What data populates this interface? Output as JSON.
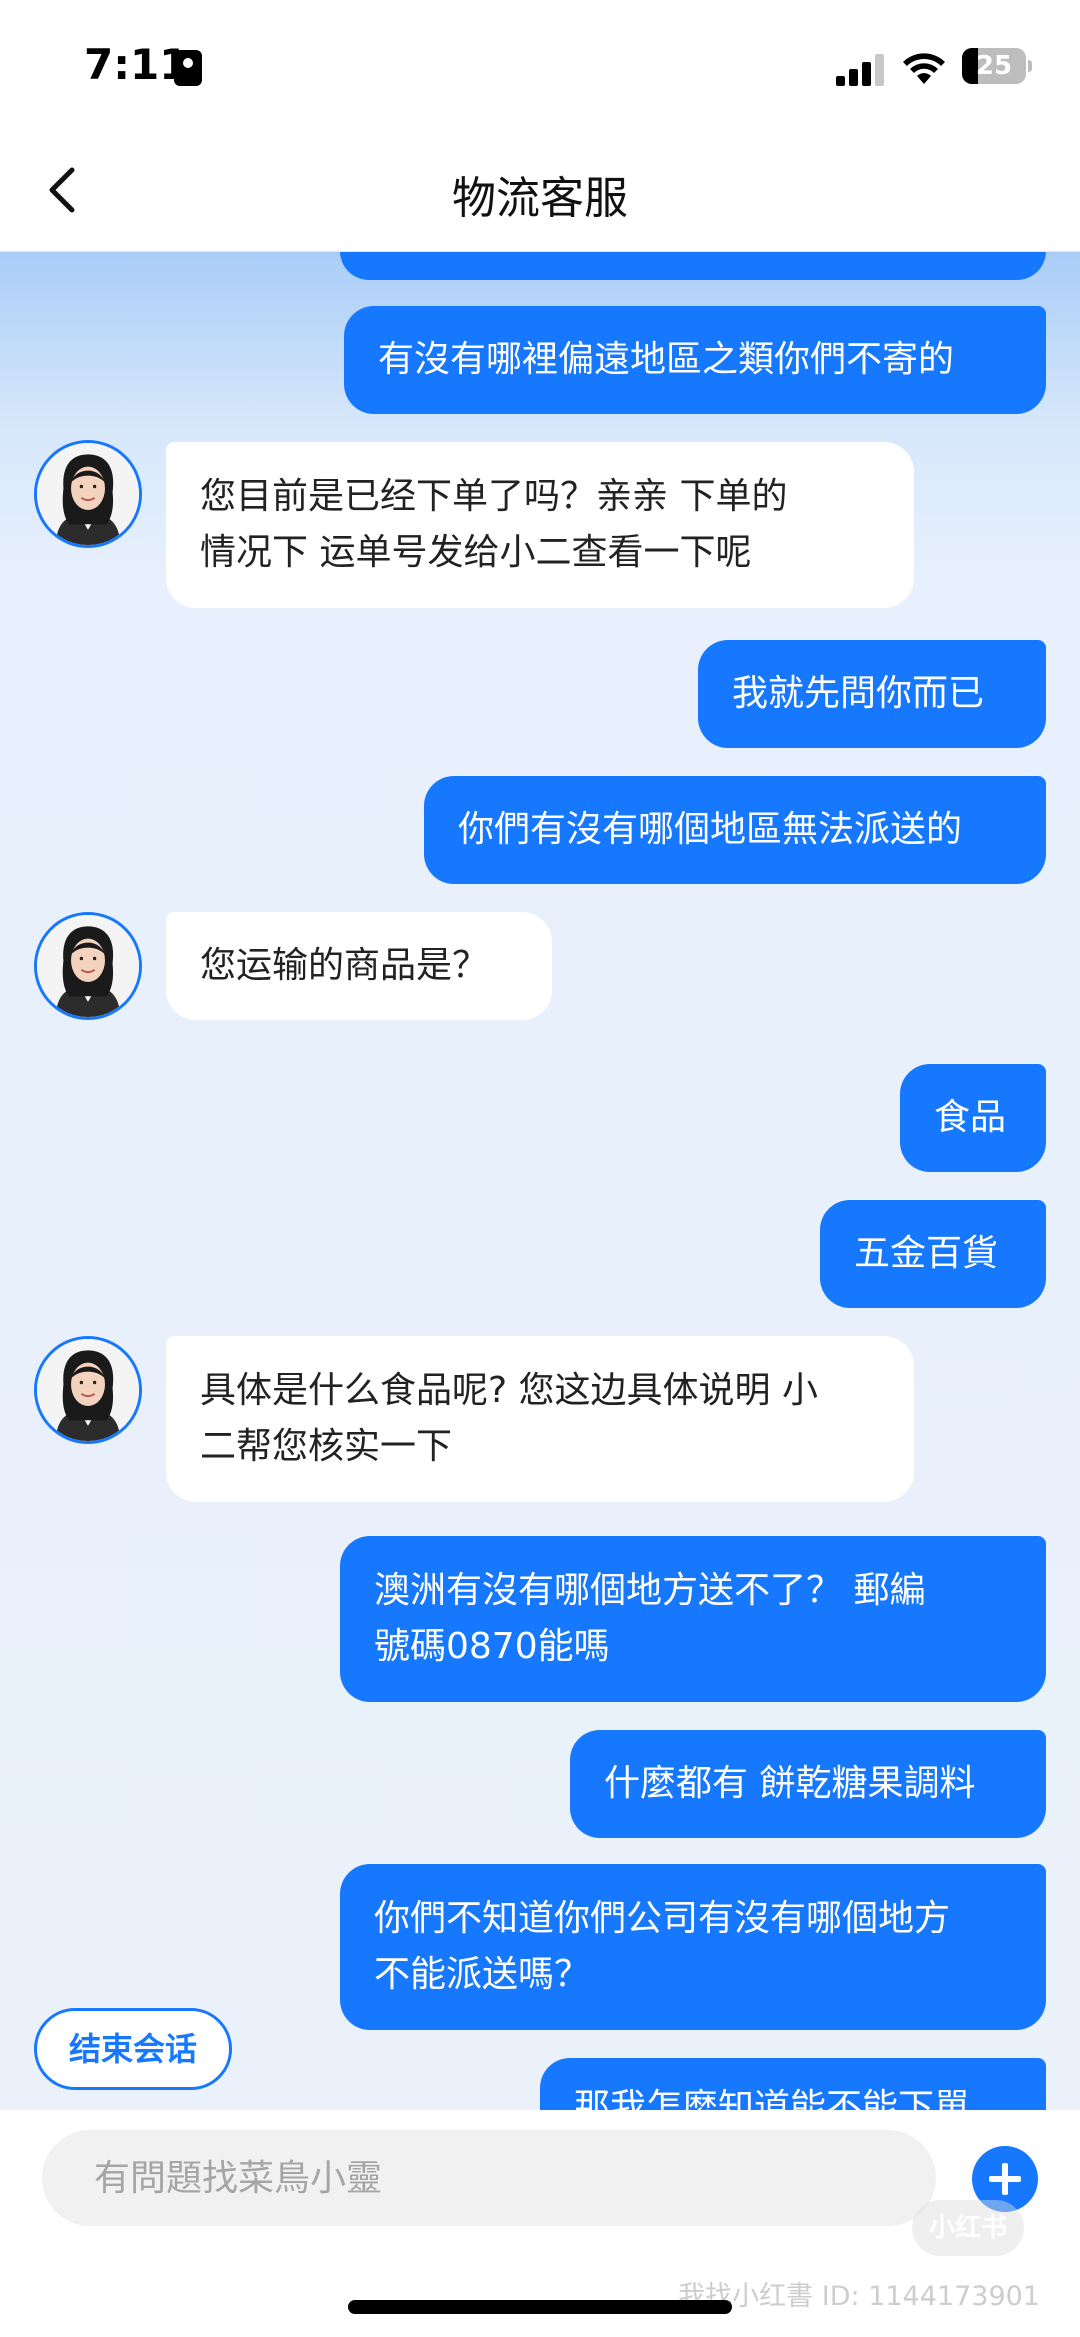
{
  "status_bar": {
    "time": "7:11",
    "battery": "25"
  },
  "header": {
    "title": "物流客服"
  },
  "messages": [
    {
      "from": "me",
      "text": ""
    },
    {
      "from": "me",
      "text": "有沒有哪裡偏遠地區之類你們不寄的"
    },
    {
      "from": "bot",
      "line1": "您目前是已经下单了吗？亲亲 下单的",
      "line2": "情况下 运单号发给小二查看一下呢"
    },
    {
      "from": "me",
      "text": "我就先問你而已"
    },
    {
      "from": "me",
      "text": "你們有沒有哪個地區無法派送的"
    },
    {
      "from": "bot",
      "text": "您运输的商品是？"
    },
    {
      "from": "me",
      "text": "食品"
    },
    {
      "from": "me",
      "text": "五金百貨"
    },
    {
      "from": "bot",
      "line1": "具体是什么食品呢? 您这边具体说明 小",
      "line2": "二帮您核实一下"
    },
    {
      "from": "me",
      "line1": "澳洲有沒有哪個地方送不了？ 郵編",
      "line2": "號碼0870能嗎"
    },
    {
      "from": "me",
      "text": "什麼都有 餅乾糖果調料"
    },
    {
      "from": "me",
      "line1": "你們不知道你們公司有沒有哪個地方",
      "line2": "不能派送嗎？"
    },
    {
      "from": "me",
      "text": "那我怎麼知道能不能下單"
    }
  ],
  "actions": {
    "end_session": "结束会话"
  },
  "input": {
    "placeholder": "有問題找菜鳥小靈"
  },
  "watermark": {
    "logo": "小红书",
    "text": "我找小红書 ID: 1144173901"
  },
  "colors": {
    "accent": "#1677ff",
    "bot_bubble": "#ffffff",
    "background": "#eaf1fb"
  }
}
